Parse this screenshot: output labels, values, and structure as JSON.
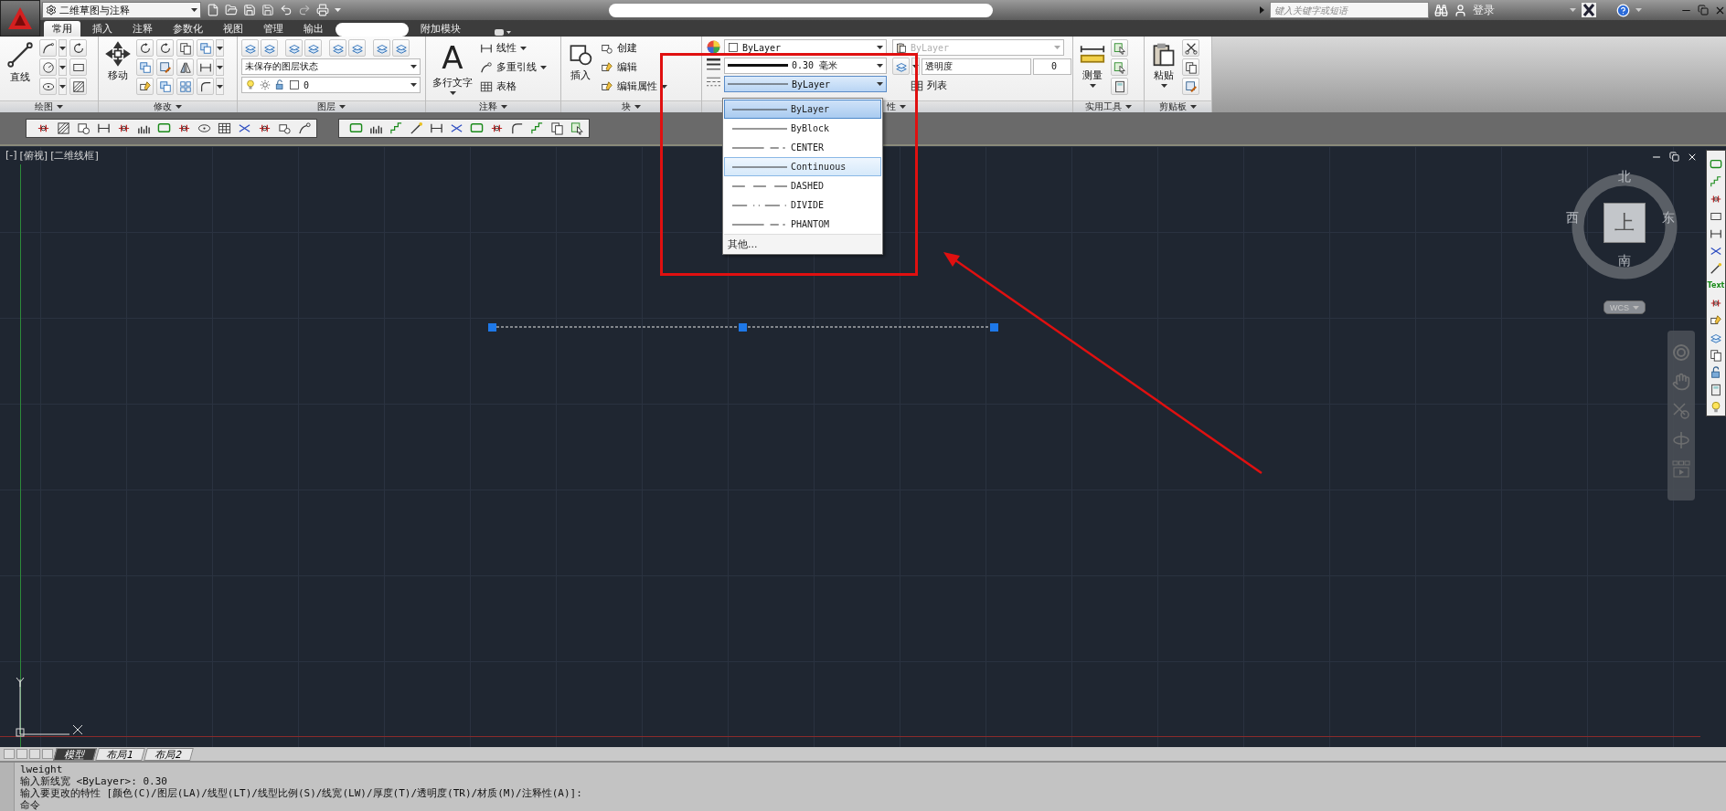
{
  "title_bar": {
    "workspace": "二维草图与注释",
    "search": {
      "placeholder": "键入关键字或短语"
    },
    "sign_in": "登录"
  },
  "ribbon_tabs": [
    {
      "label": "常用",
      "selected": true
    },
    {
      "label": "插入",
      "selected": false
    },
    {
      "label": "注释",
      "selected": false
    },
    {
      "label": "参数化",
      "selected": false
    },
    {
      "label": "视图",
      "selected": false
    },
    {
      "label": "管理",
      "selected": false
    },
    {
      "label": "输出",
      "selected": false
    },
    {
      "label": "附加模块",
      "selected": false
    }
  ],
  "panels": {
    "draw": {
      "title": "绘图",
      "big": "直线"
    },
    "modify": {
      "title": "修改",
      "big": "移动"
    },
    "layer": {
      "title": "图层",
      "layer_state": "未保存的图层状态",
      "layer": "0"
    },
    "annotation": {
      "title": "注释",
      "text_icon": "A",
      "big": "多行文字",
      "items": [
        "线性",
        "多重引线",
        "表格"
      ]
    },
    "block": {
      "title": "块",
      "big": "插入",
      "items": [
        "创建",
        "编辑",
        "编辑属性"
      ]
    },
    "properties": {
      "title": "性",
      "color_value": "ByLayer",
      "lineweight": "0.30 毫米",
      "linetype": {
        "value": "ByLayer",
        "open": true
      },
      "plot_style": {
        "value": "ByLayer",
        "disabled": true
      },
      "transparency_label": "透明度",
      "transparency": "0",
      "list": "列表"
    },
    "utilities": {
      "title": "实用工具",
      "big": "测量"
    },
    "clipboard": {
      "title": "剪贴板",
      "big": "粘贴"
    }
  },
  "linetype_list": [
    {
      "label": "ByLayer",
      "kind": "solid",
      "selected": true,
      "hovered": false
    },
    {
      "label": "ByBlock",
      "kind": "solid",
      "selected": false,
      "hovered": false
    },
    {
      "label": "CENTER",
      "kind": "center",
      "selected": false,
      "hovered": false
    },
    {
      "label": "Continuous",
      "kind": "solid",
      "selected": false,
      "hovered": true
    },
    {
      "label": "DASHED",
      "kind": "dashed",
      "selected": false,
      "hovered": false
    },
    {
      "label": "DIVIDE",
      "kind": "divide",
      "selected": false,
      "hovered": false
    },
    {
      "label": "PHANTOM",
      "kind": "phantom",
      "selected": false,
      "hovered": false
    }
  ],
  "linetype_more": "其他...",
  "viewport": {
    "controls": [
      "[-]",
      "[俯视]",
      "[二维线框]"
    ],
    "viewcube": {
      "north": "北",
      "south": "南",
      "east": "东",
      "west": "西",
      "face": "上",
      "ucs": "WCS"
    }
  },
  "side_toolbar_text": "Text",
  "layout_tabs": [
    {
      "label": "模型",
      "selected": true
    },
    {
      "label": "布局1",
      "selected": false
    },
    {
      "label": "布局2",
      "selected": false
    }
  ],
  "command_lines": [
    "lweight",
    "输入新线宽 <ByLayer>: 0.30",
    "输入要更改的特性 [颜色(C)/图层(LA)/线型(LT)/线型比例(S)/线宽(LW)/厚度(T)/透明度(TR)/材质(M)/注释性(A)]:",
    "命令"
  ]
}
